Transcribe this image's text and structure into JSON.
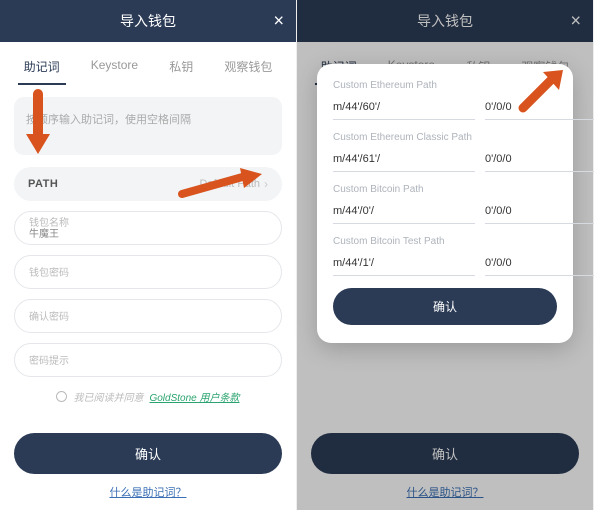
{
  "left": {
    "header": {
      "title": "导入钱包",
      "close": "×"
    },
    "tabs": [
      "助记词",
      "Keystore",
      "私钥",
      "观察钱包"
    ],
    "textarea_placeholder": "按顺序输入助记词，使用空格间隔",
    "path": {
      "label": "PATH",
      "value": "Default Path"
    },
    "fields": {
      "name_label": "钱包名称",
      "name_value": "牛魔王",
      "pwd_label": "钱包密码",
      "confirm_label": "确认密码",
      "hint_label": "密码提示"
    },
    "agree": {
      "prefix": "我已阅读并同意",
      "link": "GoldStone 用户条款"
    },
    "confirm": "确认",
    "help": "什么是助记词？"
  },
  "right": {
    "header": {
      "title": "导入钱包",
      "close": "×"
    },
    "tabs": [
      "助记词",
      "Keystore",
      "私钥",
      "观察钱包"
    ],
    "modal": {
      "groups": [
        {
          "title": "Custom Ethereum Path",
          "a": "m/44'/60'/",
          "b": "0'/0/0"
        },
        {
          "title": "Custom Ethereum Classic Path",
          "a": "m/44'/61'/",
          "b": "0'/0/0"
        },
        {
          "title": "Custom Bitcoin Path",
          "a": "m/44'/0'/",
          "b": "0'/0/0"
        },
        {
          "title": "Custom Bitcoin Test Path",
          "a": "m/44'/1'/",
          "b": "0'/0/0"
        }
      ],
      "confirm": "确认"
    },
    "confirm": "确认",
    "help": "什么是助记词？"
  }
}
